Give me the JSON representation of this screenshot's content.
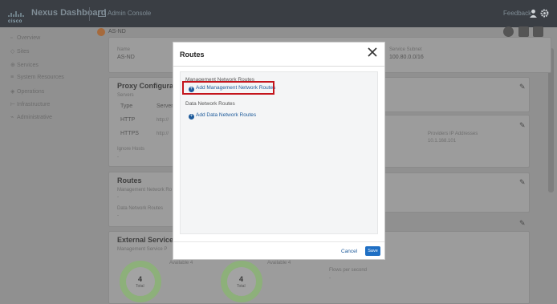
{
  "topbar": {
    "brand_word": "cisco",
    "app_title": "Nexus Dashboard",
    "console_label": "Admin Console",
    "feedback_label": "Feedback"
  },
  "sidebar": {
    "items": [
      {
        "label": "Overview",
        "icon": "grid-icon"
      },
      {
        "label": "Sites",
        "icon": "sites-icon"
      },
      {
        "label": "Services",
        "icon": "services-icon"
      },
      {
        "label": "System Resources",
        "icon": "resources-icon"
      },
      {
        "label": "Operations",
        "icon": "operations-icon"
      },
      {
        "label": "Infrastructure",
        "icon": "infrastructure-icon"
      },
      {
        "label": "Administrative",
        "icon": "admin-icon"
      }
    ]
  },
  "site": {
    "label": "AS-ND"
  },
  "background": {
    "cluster": {
      "name_label": "Name",
      "name_value": "AS-ND",
      "subnet_label": "Service Subnet",
      "subnet_value": "100.80.0.0/16"
    },
    "proxy": {
      "title": "Proxy Configuratio",
      "servers_label": "Servers",
      "col_type": "Type",
      "col_server": "Server",
      "rows": [
        {
          "type": "HTTP",
          "server": "http://"
        },
        {
          "type": "HTTPS",
          "server": "http://"
        }
      ],
      "ignore_label": "Ignore Hosts",
      "ignore_value": "-"
    },
    "providers": {
      "label": "Providers IP Addresses",
      "value": "10.1.168.101"
    },
    "routes": {
      "title": "Routes",
      "mgmt_label": "Management Network Ro",
      "mgmt_value": "-",
      "data_label": "Data Network Routes",
      "data_value": "-"
    },
    "external": {
      "title": "External Service P",
      "sub_label": "Management Service P",
      "donut1": {
        "num": "4",
        "sub": "Total"
      },
      "donut2": {
        "num": "4",
        "sub": "Total"
      },
      "avail1": "Available 4",
      "avail2": "Available 4",
      "flows_label": "Flows per second",
      "flows_value": "-"
    }
  },
  "modal": {
    "title": "Routes",
    "mgmt_section": "Management Network Routes",
    "add_mgmt": "Add Management Network Routes",
    "data_section": "Data Network Routes",
    "add_data": "Add Data Network Routes",
    "cancel": "Cancel",
    "save": "Save"
  },
  "colors": {
    "accent": "#1f6fc4",
    "highlight": "#c4151c",
    "topbar": "#3a3e44"
  }
}
